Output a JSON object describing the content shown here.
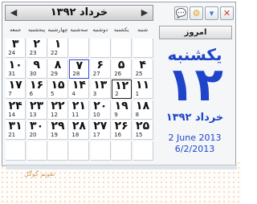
{
  "calendar": {
    "month_title": "خرداد ۱۳۹۲",
    "nav_prev": "◀",
    "nav_next": "▶",
    "weekdays": [
      "شنبه",
      "یکشنبه",
      "دوشنبه",
      "سه‌شنبه",
      "چهارشنبه",
      "پنجشنبه",
      "جمعه"
    ],
    "rows": [
      [
        {
          "p": "",
          "g": ""
        },
        {
          "p": "",
          "g": ""
        },
        {
          "p": "",
          "g": ""
        },
        {
          "p": "",
          "g": ""
        },
        {
          "p": "۱",
          "g": "22"
        },
        {
          "p": "۲",
          "g": "23"
        },
        {
          "p": "۳",
          "g": "24"
        }
      ],
      [
        {
          "p": "۴",
          "g": "25"
        },
        {
          "p": "۵",
          "g": "26"
        },
        {
          "p": "۶",
          "g": "27"
        },
        {
          "p": "۷",
          "g": "28"
        },
        {
          "p": "۸",
          "g": "29"
        },
        {
          "p": "۹",
          "g": "30"
        },
        {
          "p": "۱۰",
          "g": "31"
        }
      ],
      [
        {
          "p": "۱۱",
          "g": "1"
        },
        {
          "p": "۱۲",
          "g": "2"
        },
        {
          "p": "۱۳",
          "g": "3"
        },
        {
          "p": "۱۴",
          "g": "4"
        },
        {
          "p": "۱۵",
          "g": "5"
        },
        {
          "p": "۱۶",
          "g": "6"
        },
        {
          "p": "۱۷",
          "g": "7"
        }
      ],
      [
        {
          "p": "۱۸",
          "g": "8"
        },
        {
          "p": "۱۹",
          "g": "9"
        },
        {
          "p": "۲۰",
          "g": "10"
        },
        {
          "p": "۲۱",
          "g": "11"
        },
        {
          "p": "۲۲",
          "g": "12"
        },
        {
          "p": "۲۳",
          "g": "13"
        },
        {
          "p": "۲۴",
          "g": "14"
        }
      ],
      [
        {
          "p": "۲۵",
          "g": "15"
        },
        {
          "p": "۲۶",
          "g": "16"
        },
        {
          "p": "۲۷",
          "g": "17"
        },
        {
          "p": "۲۸",
          "g": "18"
        },
        {
          "p": "۲۹",
          "g": "19"
        },
        {
          "p": "۳۰",
          "g": "20"
        },
        {
          "p": "۳۱",
          "g": "21"
        }
      ],
      [
        {
          "p": "",
          "g": ""
        },
        {
          "p": "",
          "g": ""
        },
        {
          "p": "",
          "g": ""
        },
        {
          "p": "",
          "g": ""
        },
        {
          "p": "",
          "g": ""
        },
        {
          "p": "",
          "g": ""
        },
        {
          "p": "",
          "g": ""
        }
      ]
    ],
    "today_value": "۱۲",
    "selected_value": "۷"
  },
  "panel": {
    "today_label": "امروز",
    "weekday": "یکشنبه",
    "day": "۱۲",
    "month_year": "خرداد ۱۳۹۲",
    "gregorian": "2 June 2013",
    "short_date": "6/2/2013",
    "buttons": {
      "close": {
        "icon": "close-icon",
        "glyph": "✕"
      },
      "down": {
        "icon": "chevron-down-icon",
        "glyph": "▾"
      },
      "gear": {
        "icon": "gear-icon",
        "glyph": "⚙"
      },
      "chat": {
        "icon": "chat-bubble-icon",
        "glyph": "💬"
      }
    }
  },
  "background_text": "تقویم گوگل"
}
